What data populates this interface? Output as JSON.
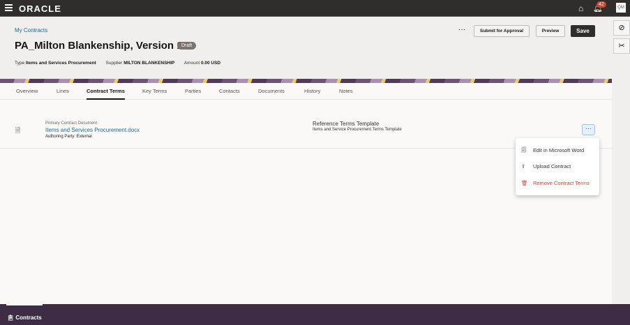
{
  "topbar": {
    "logo": "ORACLE",
    "notification_count": "42",
    "avatar": "QM"
  },
  "header": {
    "breadcrumb": "My Contracts",
    "title": "PA_Milton Blankenship, Version 1",
    "status": "Draft",
    "meta": [
      {
        "label": "Type",
        "value": "Items and Services Procurement"
      },
      {
        "label": "Supplier",
        "value": "MILTON BLANKENSHIP"
      },
      {
        "label": "Amount",
        "value": "0.00 USD"
      }
    ],
    "more": "···",
    "submit": "Submit for Approval",
    "preview": "Preview",
    "save": "Save"
  },
  "tabs": [
    "Overview",
    "Lines",
    "Contract Terms",
    "Key Terms",
    "Parties",
    "Contacts",
    "Documents",
    "History",
    "Notes"
  ],
  "document": {
    "label": "Primary Contract Document",
    "file": "Items and Services Procurement.docx",
    "authoring": "Authoring Party: External",
    "ref_label": "Reference Terms Template",
    "ref_value": "Items and Service Procurement Terms Template",
    "menu_button": "···"
  },
  "menu": [
    "Edit in Microsoft Word",
    "Upload Contract",
    "Remove Contract Terms"
  ],
  "bottom": {
    "label": "Contracts"
  }
}
